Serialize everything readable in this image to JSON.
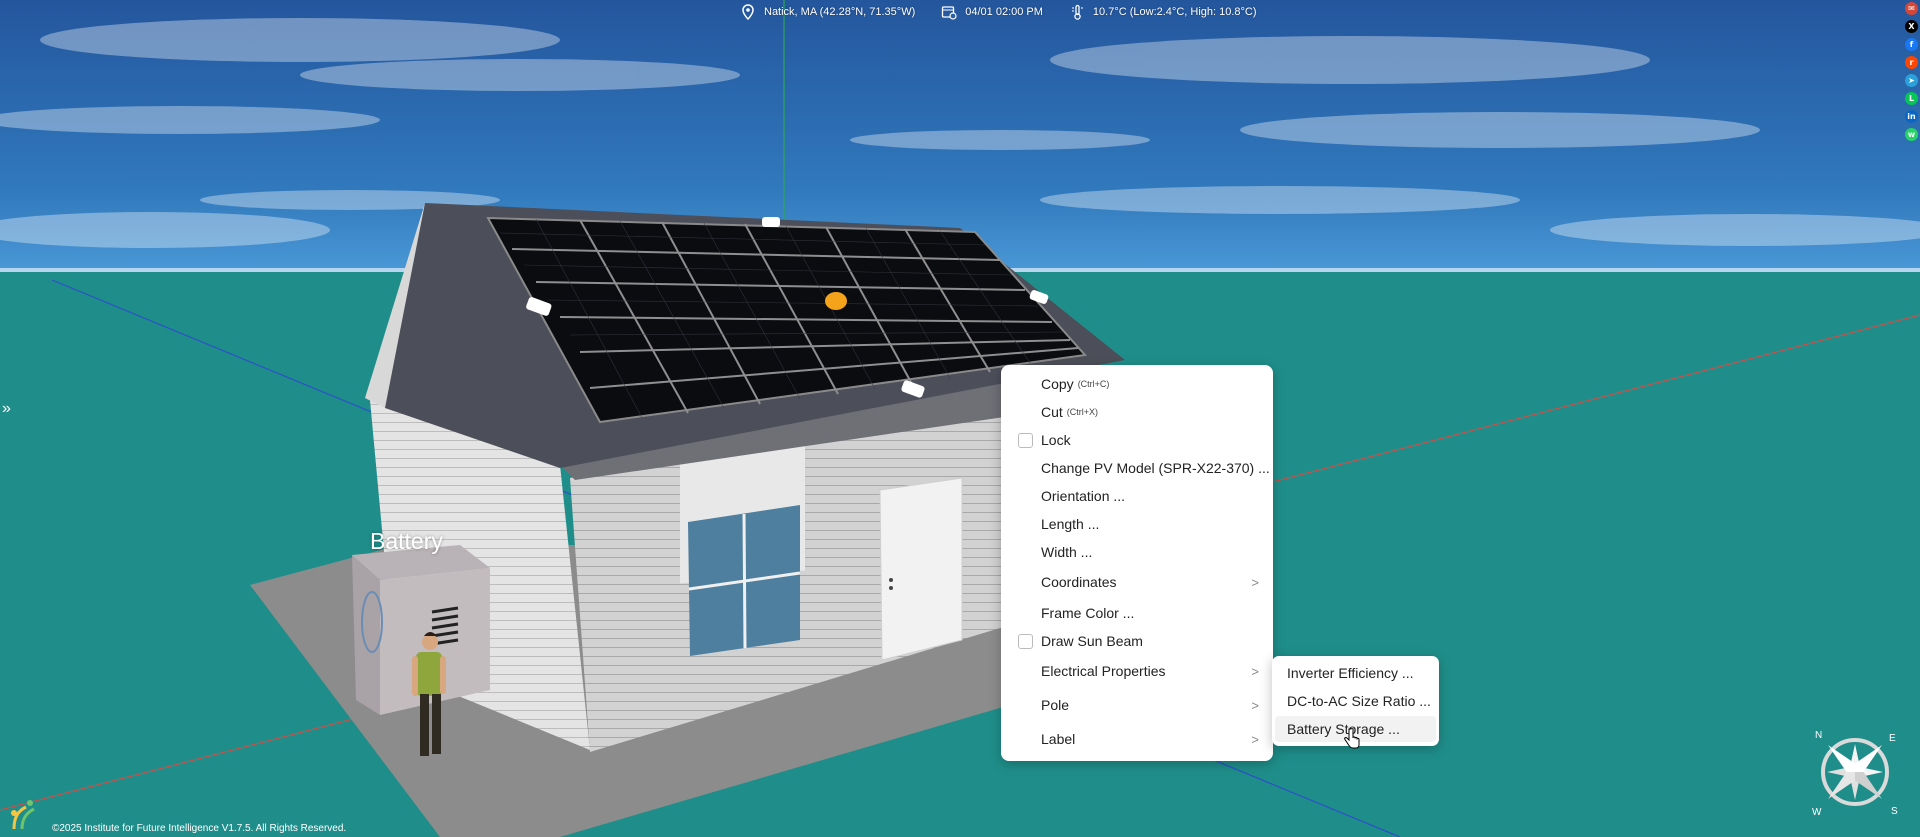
{
  "topbar": {
    "location": "Natick, MA (42.28°N, 71.35°W)",
    "datetime": "04/01 02:00 PM",
    "weather": "10.7°C (Low:2.4°C, High: 10.8°C)"
  },
  "scene": {
    "battery_label": "Battery"
  },
  "share_icons": [
    {
      "name": "email",
      "glyph": "✉",
      "color": "#d44638"
    },
    {
      "name": "x",
      "glyph": "X",
      "color": "#000000"
    },
    {
      "name": "facebook",
      "glyph": "f",
      "color": "#1877f2"
    },
    {
      "name": "reddit",
      "glyph": "r",
      "color": "#ff4500"
    },
    {
      "name": "telegram",
      "glyph": "➤",
      "color": "#2aa1da"
    },
    {
      "name": "line",
      "glyph": "L",
      "color": "#06c755"
    },
    {
      "name": "linkedin",
      "glyph": "in",
      "color": "#0a66c2"
    },
    {
      "name": "whatsapp",
      "glyph": "w",
      "color": "#25d366"
    }
  ],
  "sidebar": {
    "expander_glyph": "»"
  },
  "context_menu": {
    "copy": "Copy",
    "copy_hint": "(Ctrl+C)",
    "cut": "Cut",
    "cut_hint": "(Ctrl+X)",
    "lock": "Lock",
    "change_pv_model": "Change PV Model (SPR-X22-370) ...",
    "orientation": "Orientation ...",
    "length": "Length ...",
    "width": "Width ...",
    "coordinates": "Coordinates",
    "frame_color": "Frame Color ...",
    "draw_sun_beam": "Draw Sun Beam",
    "electrical_properties": "Electrical Properties",
    "pole": "Pole",
    "label": "Label",
    "arrow": ">"
  },
  "submenu": {
    "inverter_efficiency": "Inverter Efficiency ...",
    "dc_to_ac": "DC-to-AC Size Ratio ...",
    "battery_storage": "Battery Storage ..."
  },
  "compass": {
    "n": "N",
    "e": "E",
    "s": "S",
    "w": "W"
  },
  "footer": {
    "copyright": "©2025 Institute for Future Intelligence V1.7.5. All Rights Reserved."
  },
  "colors": {
    "sky_top": "#2a5fa8",
    "sky_horizon": "#3f8fd0",
    "ground": "#1f8e8a",
    "sun_marker": "#f5a31a"
  }
}
